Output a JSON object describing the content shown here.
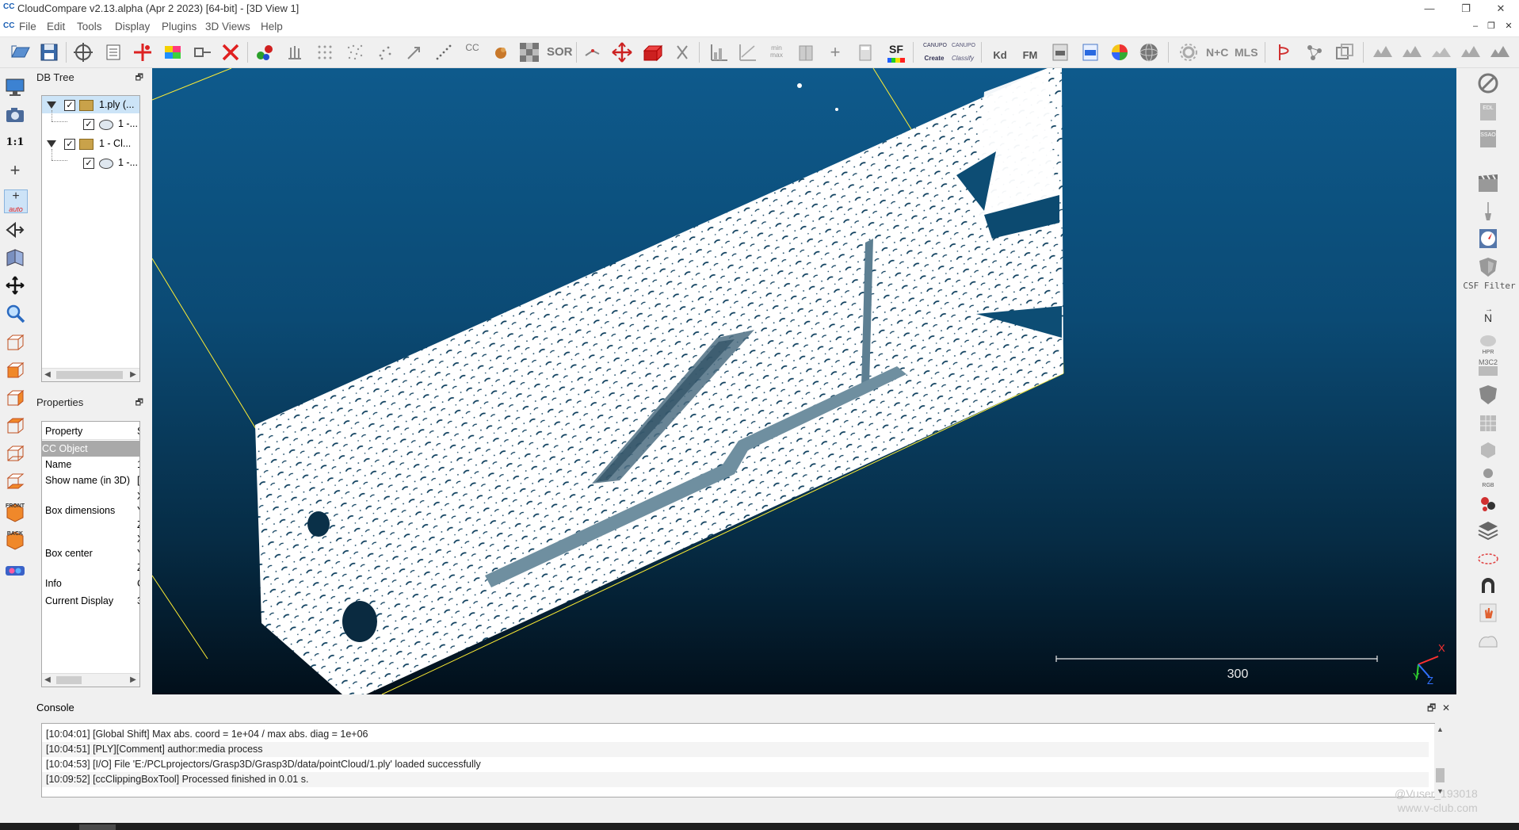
{
  "app": {
    "title": "CloudCompare v2.13.alpha (Apr  2 2023) [64-bit] - [3D View 1]",
    "logo_text": "CC",
    "win_minimize": "—",
    "win_maximize": "❐",
    "win_close": "✕"
  },
  "menu": {
    "items": [
      "File",
      "Edit",
      "Tools",
      "Display",
      "Plugins",
      "3D Views",
      "Help"
    ],
    "mdi_minimize": "–",
    "mdi_restore": "❐",
    "mdi_close": "✕"
  },
  "toolbar": {
    "text_icons": {
      "cc": "CC",
      "sor": "SOR",
      "sf": "SF",
      "canupo_create_top": "CANUPO",
      "canupo_create": "Create",
      "canupo_classify_top": "CANUPO",
      "canupo_classify": "Classify",
      "kd": "Kd",
      "fm": "FM",
      "n_c": "N+C",
      "mls": "MLS",
      "min_max": "min max"
    }
  },
  "left_toolbar": {
    "scale_label": "1:1",
    "auto_label": "auto",
    "front_label": "FRONT",
    "back_label": "BACK"
  },
  "right_toolbar": {
    "csf_label": "CSF Filter",
    "north_label": "N",
    "hpr_label": "HPR",
    "m3c2_label": "M3C2",
    "edl_label": "EDL",
    "ssao_label": "SSAO",
    "rgb_label": "RGB"
  },
  "db_tree": {
    "title": "DB Tree",
    "pin": "🗗",
    "rows": [
      {
        "label": "1.ply (..."
      },
      {
        "label": "1 -..."
      },
      {
        "label": "1 - Cl..."
      },
      {
        "label": "1 -..."
      }
    ]
  },
  "properties": {
    "title": "Properties",
    "pin": "🗗",
    "header": "Property",
    "header_value": "S",
    "group": "CC Object",
    "rows": [
      {
        "key": "Name",
        "value": "1"
      },
      {
        "key": "Show name (in 3D)",
        "value": "["
      },
      {
        "key": "",
        "value": "X"
      },
      {
        "key": "Box dimensions",
        "value": "Y"
      },
      {
        "key": "",
        "value": "Z"
      },
      {
        "key": "",
        "value": "X"
      },
      {
        "key": "Box center",
        "value": "Y"
      },
      {
        "key": "",
        "value": "Z"
      },
      {
        "key": "Info",
        "value": "C"
      },
      {
        "key": "Current Display",
        "value": "3"
      }
    ]
  },
  "view3d": {
    "scale_value": "300",
    "axis_x": "X",
    "axis_y": "Y",
    "axis_z": "Z"
  },
  "console": {
    "title": "Console",
    "float_btn": "🗗",
    "close_btn": "✕",
    "lines": [
      "[10:04:01] [Global Shift] Max abs. coord = 1e+04 / max abs. diag = 1e+06",
      "[10:04:51] [PLY][Comment] author:media process",
      "[10:04:53] [I/O] File 'E:/PCLprojectors/Grasp3D/Grasp3D/data/pointCloud/1.ply' loaded successfully",
      "[10:09:52] [ccClippingBoxTool] Processed finished in 0.01 s."
    ]
  },
  "watermark": {
    "line1": "@Vuser_193018",
    "line2": "www.v-club.com"
  }
}
